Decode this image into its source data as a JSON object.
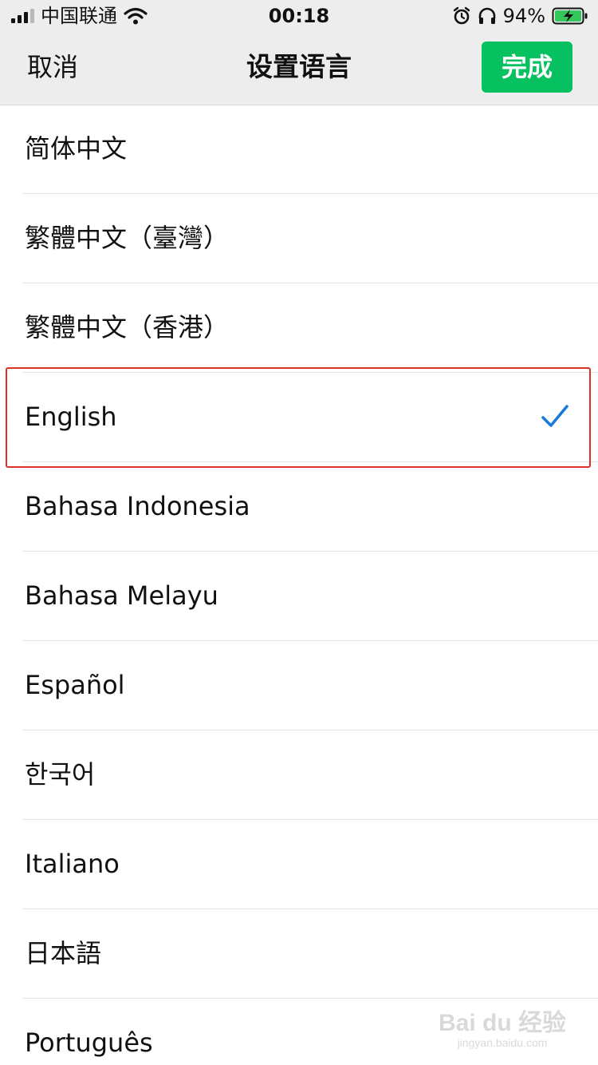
{
  "status_bar": {
    "carrier": "中国联通",
    "time": "00:18",
    "battery_percent": "94%",
    "icons": [
      "signal-icon",
      "wifi-icon",
      "alarm-icon",
      "headphones-icon",
      "battery-charging-icon"
    ]
  },
  "nav": {
    "cancel_label": "取消",
    "title": "设置语言",
    "done_label": "完成"
  },
  "languages": [
    {
      "label": "简体中文",
      "selected": false
    },
    {
      "label": "繁體中文（臺灣）",
      "selected": false
    },
    {
      "label": "繁體中文（香港）",
      "selected": false
    },
    {
      "label": "English",
      "selected": true
    },
    {
      "label": "Bahasa Indonesia",
      "selected": false
    },
    {
      "label": "Bahasa Melayu",
      "selected": false
    },
    {
      "label": "Español",
      "selected": false
    },
    {
      "label": "한국어",
      "selected": false
    },
    {
      "label": "Italiano",
      "selected": false
    },
    {
      "label": "日本語",
      "selected": false
    },
    {
      "label": "Português",
      "selected": false
    }
  ],
  "watermark": {
    "main": "Bai du 经验",
    "sub": "jingyan.baidu.com"
  },
  "colors": {
    "done_button": "#07c160",
    "check": "#1a7cd8",
    "highlight": "#d9322a"
  }
}
